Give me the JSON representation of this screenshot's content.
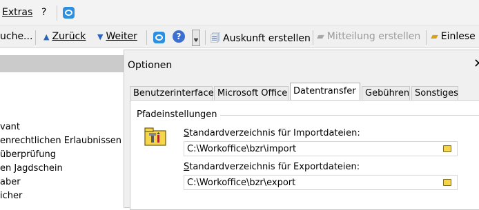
{
  "menubar": {
    "extras_label": "Extras",
    "help_label": "?"
  },
  "toolbar": {
    "suche_label": "uche...",
    "zurueck_label": "Zurück",
    "weiter_label": "Weiter",
    "auskunft_label": "Auskunft erstellen",
    "mitteilung_label": "Mitteilung erstellen",
    "einlesen_label": "Einlese"
  },
  "left_list": {
    "items": [
      "vant",
      "enrechtlichen Erlaubnissen",
      "überprüfung",
      "en Jagdschein",
      "aber",
      "icher"
    ]
  },
  "dialog": {
    "title": "Optionen",
    "close_glyph": "✕",
    "tabs": [
      {
        "label": "Benutzerinterface",
        "active": false
      },
      {
        "label": "Microsoft Office",
        "active": false
      },
      {
        "label": "Datentransfer",
        "active": true
      },
      {
        "label": "Gebühren",
        "active": false
      },
      {
        "label": "Sonstiges",
        "active": false
      }
    ],
    "group_title": "Pfadeinstellungen",
    "import_label_first": "S",
    "import_label_rest": "tandardverzeichnis für Importdateien:",
    "import_value": "C:\\Workoffice\\bzr\\import",
    "export_label_first": "S",
    "export_label_rest": "tandardverzeichnis für Exportdateien:",
    "export_value": "C:\\Workoffice\\bzr\\export"
  },
  "colors": {
    "accent_blue": "#2d8fe0",
    "selected_header": "#cbcbcb",
    "folder_yellow": "#f5d54a"
  }
}
